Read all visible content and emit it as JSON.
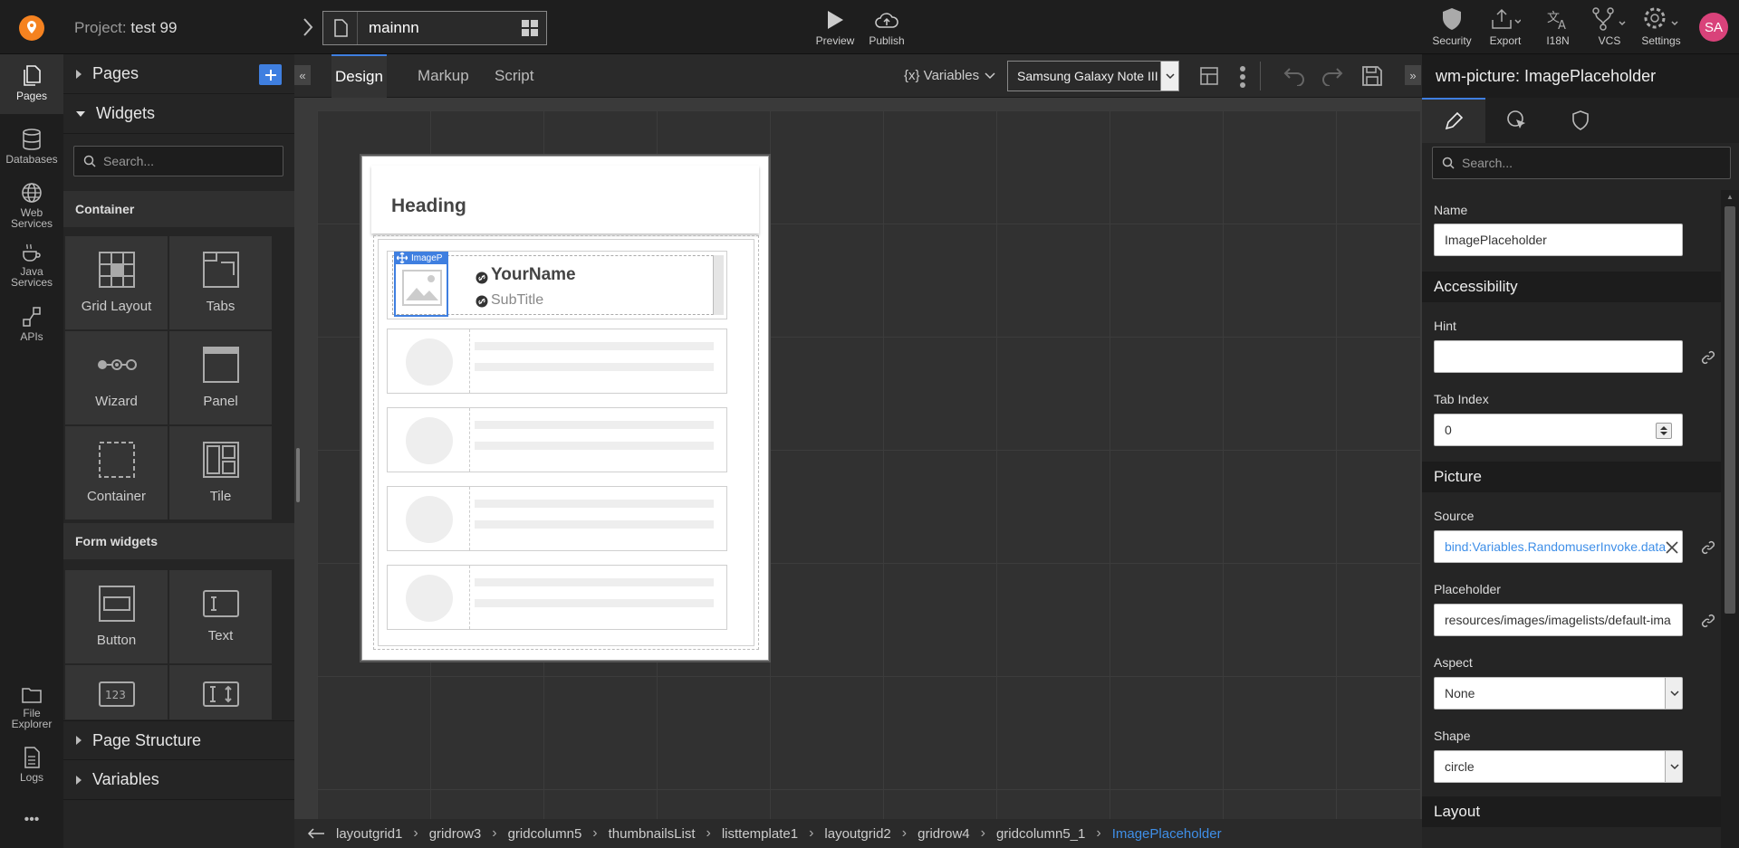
{
  "topbar": {
    "project_label": "Project:",
    "project_name": "test 99",
    "page_name": "mainnn",
    "preview": "Preview",
    "publish": "Publish",
    "security": "Security",
    "export": "Export",
    "i18n": "I18N",
    "vcs": "VCS",
    "settings": "Settings",
    "avatar": "SA"
  },
  "rail": {
    "pages": "Pages",
    "databases": "Databases",
    "web_services_1": "Web",
    "web_services_2": "Services",
    "java_services_1": "Java",
    "java_services_2": "Services",
    "apis": "APIs",
    "file_explorer_1": "File",
    "file_explorer_2": "Explorer",
    "logs": "Logs",
    "more": "•••"
  },
  "left": {
    "pages": "Pages",
    "widgets": "Widgets",
    "search_placeholder": "Search...",
    "container_label": "Container",
    "tiles_container": [
      "Grid Layout",
      "Tabs",
      "Wizard",
      "Panel",
      "Container",
      "Tile"
    ],
    "form_label": "Form widgets",
    "tiles_form": [
      "Button",
      "Text"
    ],
    "page_structure": "Page Structure",
    "variables": "Variables"
  },
  "toolbar": {
    "tabs": [
      "Design",
      "Markup",
      "Script"
    ],
    "variables": "{x} Variables",
    "device": "Samsung Galaxy Note III"
  },
  "device": {
    "heading": "Heading",
    "badge": "ImageP",
    "name": "YourName",
    "subtitle": "SubTitle"
  },
  "breadcrumb": [
    "layoutgrid1",
    "gridrow3",
    "gridcolumn5",
    "thumbnailsList",
    "listtemplate1",
    "layoutgrid2",
    "gridrow4",
    "gridcolumn5_1",
    "ImagePlaceholder"
  ],
  "right": {
    "title": "wm-picture: ImagePlaceholder",
    "search_placeholder": "Search...",
    "name_label": "Name",
    "name_value": "ImagePlaceholder",
    "accessibility": "Accessibility",
    "hint_label": "Hint",
    "hint_value": "",
    "tabindex_label": "Tab Index",
    "tabindex_value": "0",
    "picture": "Picture",
    "source_label": "Source",
    "source_value": "bind:Variables.RandomuserInvoke.data",
    "placeholder_label": "Placeholder",
    "placeholder_value": "resources/images/imagelists/default-ima",
    "aspect_label": "Aspect",
    "aspect_value": "None",
    "shape_label": "Shape",
    "shape_value": "circle",
    "layout": "Layout"
  },
  "colors": {
    "accent": "#3f7fe0",
    "brand": "#f58220",
    "avatar": "#d9427a"
  }
}
